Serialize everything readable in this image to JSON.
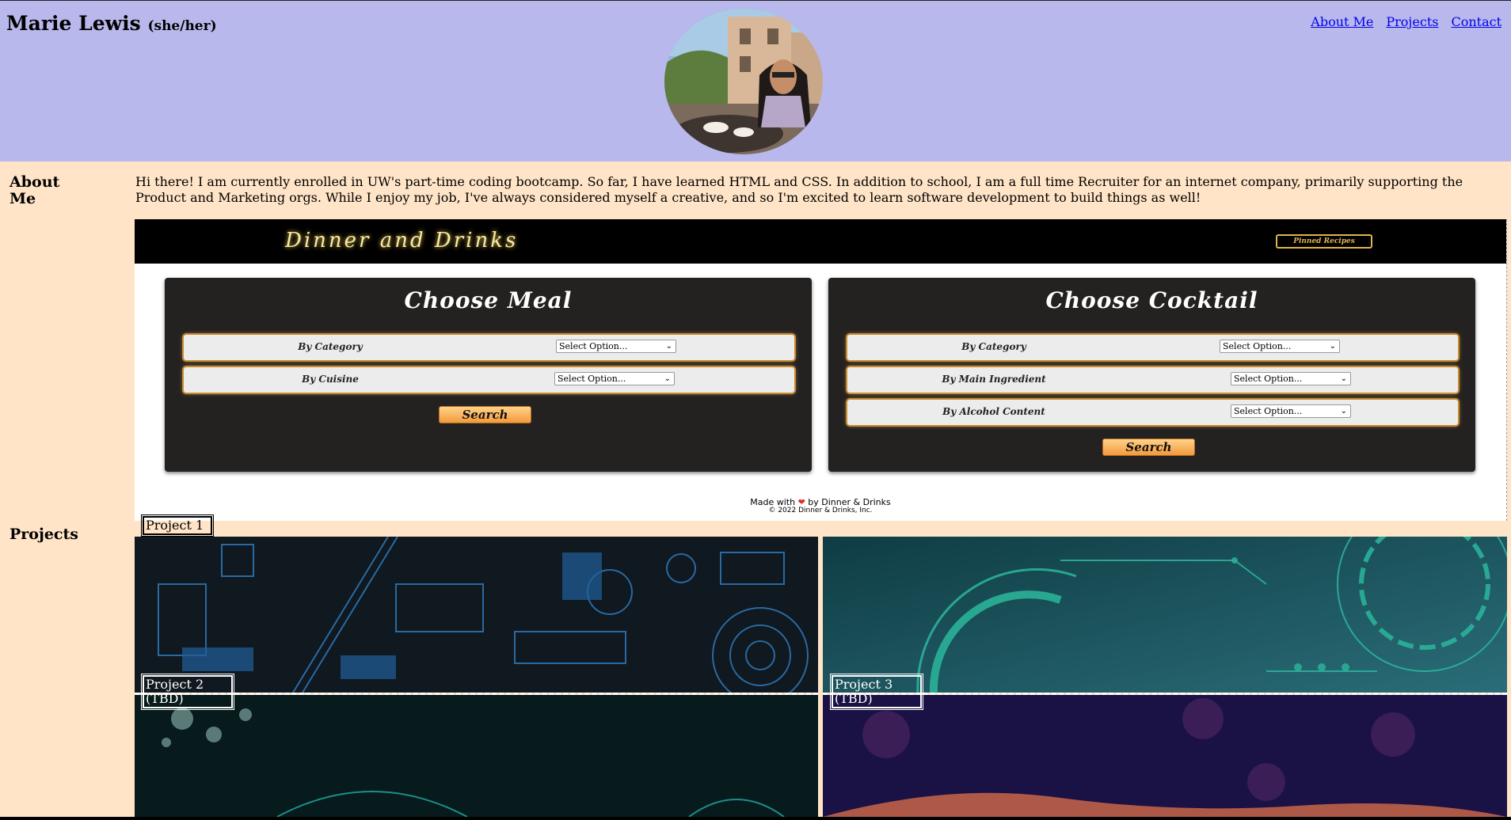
{
  "header": {
    "name": "Marie Lewis",
    "pronouns": "(she/her)",
    "nav": [
      "About Me",
      "Projects",
      "Contact"
    ]
  },
  "about": {
    "label_line1": "About",
    "label_line2": "Me",
    "text": "Hi there! I am currently enrolled in UW's part-time coding bootcamp. So far, I have learned HTML and CSS. In addition to school, I am a full time Recruiter for an internet company, primarily supporting the Product and Marketing orgs. While I enjoy my job, I've always considered myself a creative, and so I'm excited to learn software development to build things as well!"
  },
  "dinner_drinks": {
    "logo": "Dinner and Drinks",
    "pinned": "Pinned Recipes",
    "meal": {
      "title": "Choose Meal",
      "rows": [
        {
          "label": "By Category",
          "select": "Select Option..."
        },
        {
          "label": "By Cuisine",
          "select": "Select Option..."
        }
      ],
      "search": "Search"
    },
    "cocktail": {
      "title": "Choose Cocktail",
      "rows": [
        {
          "label": "By Category",
          "select": "Select Option..."
        },
        {
          "label": "By Main Ingredient",
          "select": "Select Option..."
        },
        {
          "label": "By Alcohol Content",
          "select": "Select Option..."
        }
      ],
      "search": "Search"
    },
    "footer_made": "Made with",
    "footer_by": "by Dinner & Drinks",
    "footer_copy": "© 2022 Dinner & Drinks, Inc."
  },
  "projects": {
    "label": "Projects",
    "project1": "Project 1",
    "project2_line1": "Project 2",
    "project2_line2": "(TBD)",
    "project3_line1": "Project 3",
    "project3_line2": "(TBD)"
  }
}
